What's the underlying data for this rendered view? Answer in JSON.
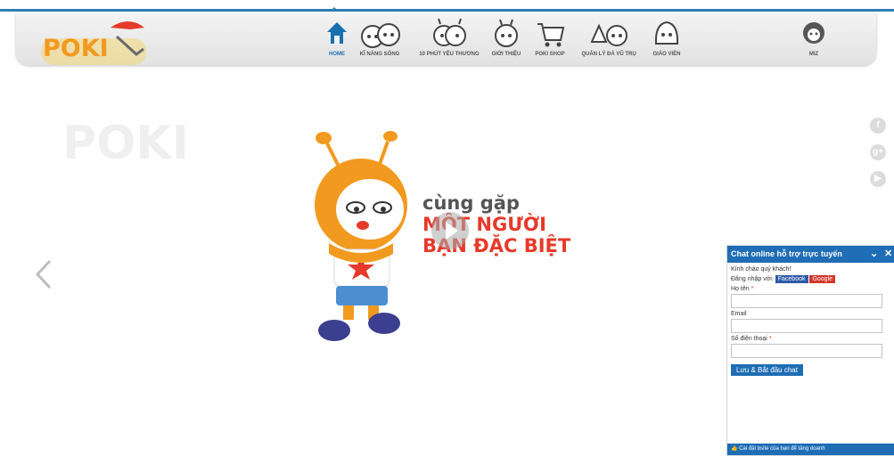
{
  "brand": {
    "logo_text": "POKI"
  },
  "nav": {
    "items": [
      {
        "label": "HOME",
        "icon": "home-icon"
      },
      {
        "label": "KĨ NĂNG SỐNG",
        "icon": "kids-icon"
      },
      {
        "label": "10 PHÚT YÊU THƯƠNG",
        "icon": "poki-pair-icon"
      },
      {
        "label": "GIỚI THIỆU",
        "icon": "poki-face-icon"
      },
      {
        "label": "POKI SHOP",
        "icon": "cart-icon"
      },
      {
        "label": "QUẢN LÝ ĐÁ VŨ TRỤ",
        "icon": "rocket-icon"
      },
      {
        "label": "GIÁO VIÊN",
        "icon": "teacher-icon"
      }
    ],
    "user_label": "MIZ"
  },
  "hero": {
    "line1": "cùng gặp",
    "line2": "MỘT NGƯỜI",
    "line3": "BẠN ĐẶC BIỆT"
  },
  "social": [
    "facebook-icon",
    "google-plus-icon",
    "youtube-icon"
  ],
  "chat": {
    "title": "Chat online hỗ trợ trực tuyến",
    "greeting": "Kính chào quý khách!",
    "login_with": "Đăng nhập với:",
    "facebook_label": "Facebook",
    "google_label": "Google",
    "name_label": "Họ tên",
    "email_label": "Email",
    "phone_label": "Số điện thoại",
    "required_mark": "*",
    "name_value": "",
    "email_value": "",
    "phone_value": "",
    "submit_label": "Lưu & Bắt đầu chat",
    "footer_text": "Cài đặt   bsite của bạn để tăng doanh"
  },
  "colors": {
    "accent": "#1f6db4",
    "brand_orange": "#f29a1f",
    "brand_red": "#e63a2a"
  }
}
